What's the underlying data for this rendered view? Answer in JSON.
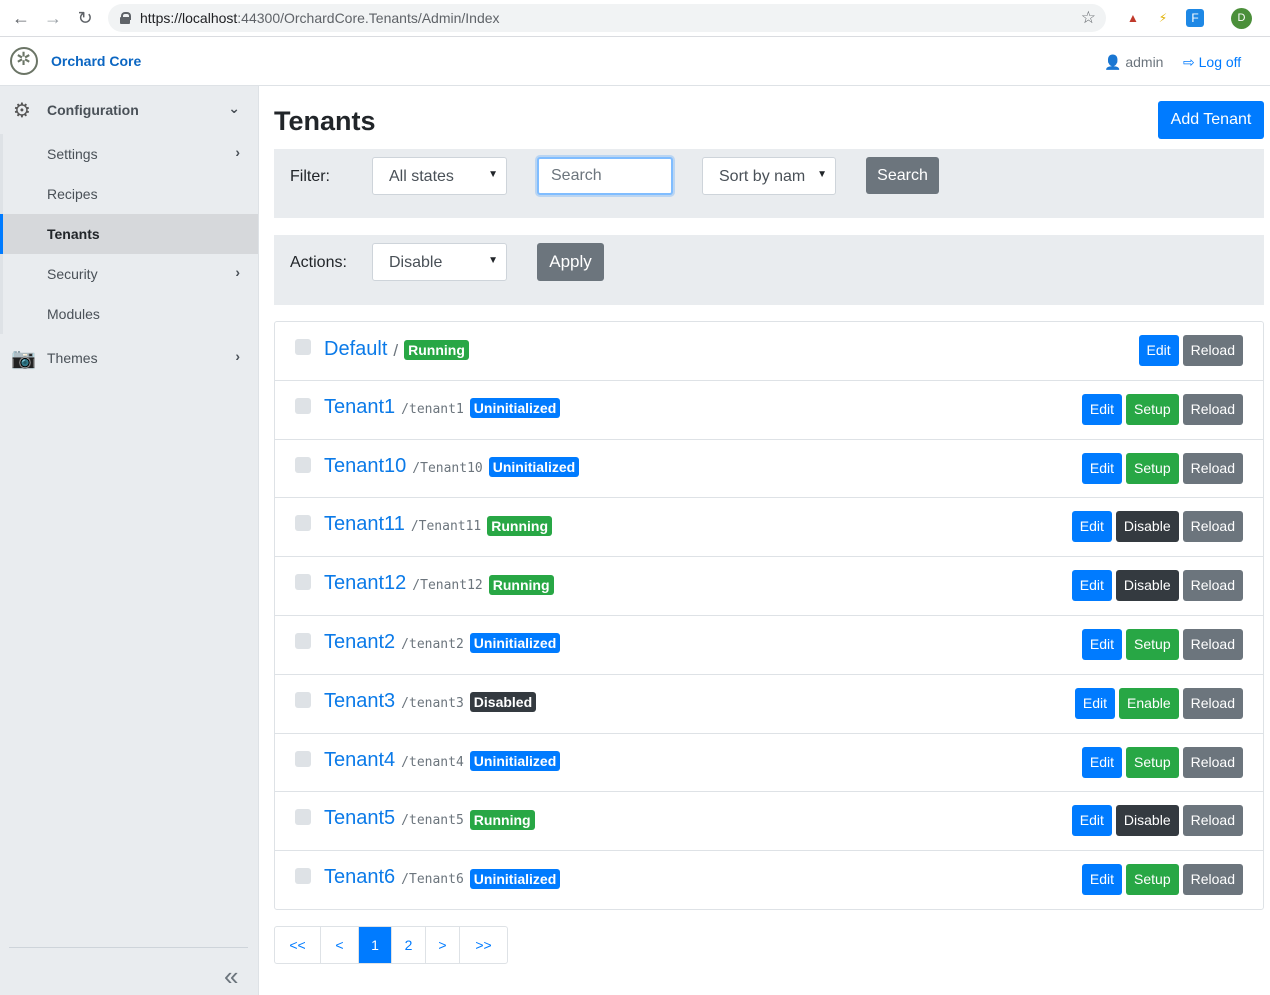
{
  "browser": {
    "url_host": "https://localhost",
    "url_path": ":44300/OrchardCore.Tenants/Admin/Index",
    "profile_initial": "D"
  },
  "topbar": {
    "brand": "Orchard Core",
    "user": "admin",
    "logoff": "Log off"
  },
  "sidebar": {
    "configuration": "Configuration",
    "items": [
      {
        "label": "Settings",
        "has_chevron": true
      },
      {
        "label": "Recipes",
        "has_chevron": false
      },
      {
        "label": "Tenants",
        "has_chevron": false,
        "active": true
      },
      {
        "label": "Security",
        "has_chevron": true
      },
      {
        "label": "Modules",
        "has_chevron": false
      }
    ],
    "themes": "Themes"
  },
  "main": {
    "title": "Tenants",
    "add_tenant": "Add Tenant",
    "filter_label": "Filter:",
    "state_filter": "All states",
    "search_placeholder": "Search",
    "sort": "Sort by nam",
    "search_button": "Search",
    "actions_label": "Actions:",
    "bulk_action": "Disable",
    "apply_button": "Apply"
  },
  "tenants": [
    {
      "name": "Default",
      "path": "/",
      "status": "Running",
      "actions": [
        "Edit",
        "Reload"
      ]
    },
    {
      "name": "Tenant1",
      "path": "/tenant1",
      "status": "Uninitialized",
      "actions": [
        "Edit",
        "Setup",
        "Reload"
      ]
    },
    {
      "name": "Tenant10",
      "path": "/Tenant10",
      "status": "Uninitialized",
      "actions": [
        "Edit",
        "Setup",
        "Reload"
      ]
    },
    {
      "name": "Tenant11",
      "path": "/Tenant11",
      "status": "Running",
      "actions": [
        "Edit",
        "Disable",
        "Reload"
      ]
    },
    {
      "name": "Tenant12",
      "path": "/Tenant12",
      "status": "Running",
      "actions": [
        "Edit",
        "Disable",
        "Reload"
      ]
    },
    {
      "name": "Tenant2",
      "path": "/tenant2",
      "status": "Uninitialized",
      "actions": [
        "Edit",
        "Setup",
        "Reload"
      ]
    },
    {
      "name": "Tenant3",
      "path": "/tenant3",
      "status": "Disabled",
      "actions": [
        "Edit",
        "Enable",
        "Reload"
      ]
    },
    {
      "name": "Tenant4",
      "path": "/tenant4",
      "status": "Uninitialized",
      "actions": [
        "Edit",
        "Setup",
        "Reload"
      ]
    },
    {
      "name": "Tenant5",
      "path": "/tenant5",
      "status": "Running",
      "actions": [
        "Edit",
        "Disable",
        "Reload"
      ]
    },
    {
      "name": "Tenant6",
      "path": "/Tenant6",
      "status": "Uninitialized",
      "actions": [
        "Edit",
        "Setup",
        "Reload"
      ]
    }
  ],
  "pagination": {
    "first": "<<",
    "prev": "<",
    "pages": [
      "1",
      "2"
    ],
    "current": "1",
    "next": ">",
    "last": ">>"
  },
  "colors": {
    "primary": "#007bff",
    "success": "#28a745",
    "dark": "#343a40",
    "secondary": "#6c757d"
  }
}
